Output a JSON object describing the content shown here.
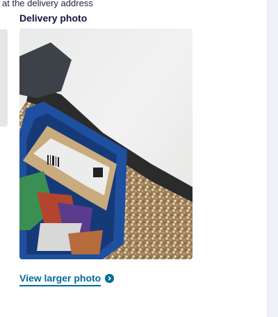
{
  "top_text": "at the delivery address",
  "delivery_photo": {
    "heading": "Delivery photo",
    "link_label": "View larger photo"
  }
}
